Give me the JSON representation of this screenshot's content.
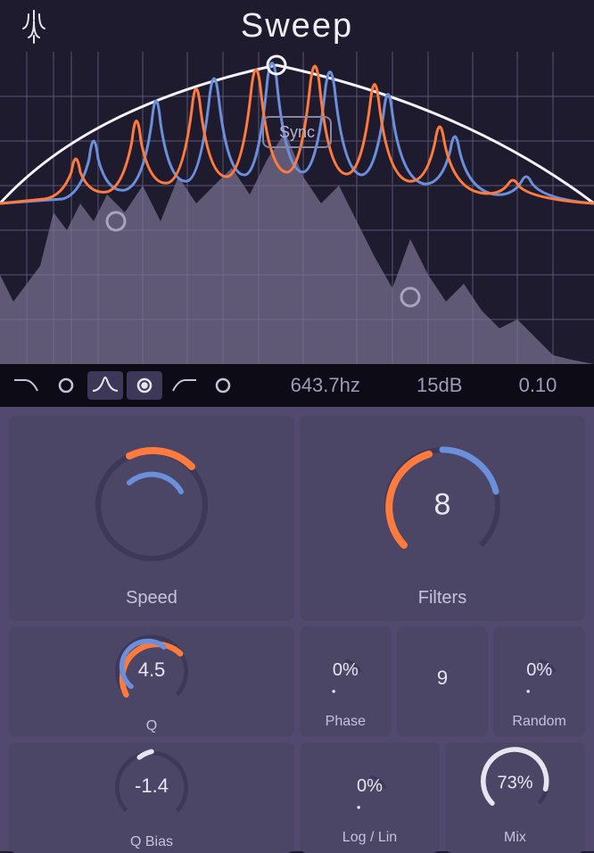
{
  "header": {
    "title": "Sweep"
  },
  "filter_bar": {
    "freq": "643.7hz",
    "gain": "15dB",
    "q": "0.10"
  },
  "knobs": {
    "sync_label": "Sync",
    "speed": {
      "label": "Speed"
    },
    "filters": {
      "label": "Filters",
      "value": "8"
    },
    "q": {
      "label": "Q",
      "value": "4.5"
    },
    "phase": {
      "label": "Phase",
      "value": "0%"
    },
    "center": {
      "value": "9"
    },
    "random": {
      "label": "Random",
      "value": "0%"
    },
    "qbias": {
      "label": "Q Bias",
      "value": "-1.4"
    },
    "loglin": {
      "label": "Log / Lin",
      "value": "0%"
    },
    "mix": {
      "label": "Mix",
      "value": "73%"
    }
  },
  "colors": {
    "accent_orange": "#ff7a3d",
    "accent_blue": "#6b8fdb",
    "bg_dark": "#1e1b2e",
    "bg_panel": "#4b4566",
    "text": "#e8e5f0"
  }
}
